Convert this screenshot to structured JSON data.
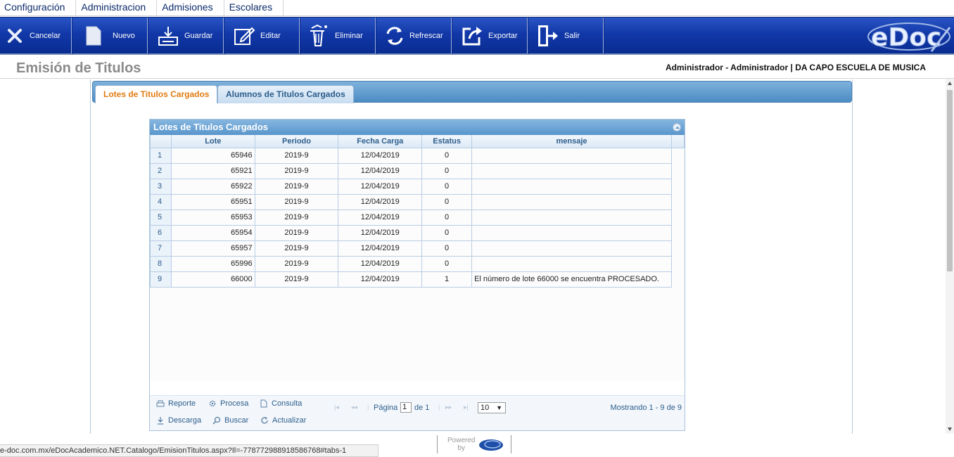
{
  "menu": [
    "Configuración",
    "Administracion",
    "Admisiones",
    "Escolares"
  ],
  "toolbar": {
    "cancel": "Cancelar",
    "new": "Nuevo",
    "save": "Guardar",
    "edit": "Editar",
    "delete": "Eliminar",
    "refresh": "Refrescar",
    "export": "Exportar",
    "exit": "Salir"
  },
  "logo": "eDoc",
  "page": {
    "title": "Emisión de Titulos",
    "user_info": "Administrador - Administrador | DA CAPO ESCUELA DE MUSICA"
  },
  "tabs": [
    "Lotes de Titulos Cargados",
    "Alumnos de Titulos Cargados"
  ],
  "grid": {
    "title": "Lotes de Titulos Cargados",
    "columns": [
      "Lote",
      "Periodo",
      "Fecha Carga",
      "Estatus",
      "mensaje"
    ],
    "rows": [
      [
        "1",
        "65946",
        "2019-9",
        "12/04/2019",
        "0",
        ""
      ],
      [
        "2",
        "65921",
        "2019-9",
        "12/04/2019",
        "0",
        ""
      ],
      [
        "3",
        "65922",
        "2019-9",
        "12/04/2019",
        "0",
        ""
      ],
      [
        "4",
        "65951",
        "2019-9",
        "12/04/2019",
        "0",
        ""
      ],
      [
        "5",
        "65953",
        "2019-9",
        "12/04/2019",
        "0",
        ""
      ],
      [
        "6",
        "65954",
        "2019-9",
        "12/04/2019",
        "0",
        ""
      ],
      [
        "7",
        "65957",
        "2019-9",
        "12/04/2019",
        "0",
        ""
      ],
      [
        "8",
        "65996",
        "2019-9",
        "12/04/2019",
        "0",
        ""
      ],
      [
        "9",
        "66000",
        "2019-9",
        "12/04/2019",
        "1",
        "El número de lote 66000 se encuentra PROCESADO."
      ]
    ]
  },
  "pager": {
    "report": "Reporte",
    "process": "Procesa",
    "query": "Consulta",
    "download": "Descarga",
    "search": "Buscar",
    "update": "Actualizar",
    "page_label": "Página",
    "page_value": "1",
    "of_label": "de 1",
    "rows_value": "10",
    "showing": "Mostrando 1 - 9 de 9"
  },
  "status_url": "e-doc.com.mx/eDocAcademico.NET.Catalogo/EmisionTitulos.aspx?Il=-778772988918586768#tabs-1",
  "powered": {
    "line1": "Powered",
    "line2": "by"
  }
}
